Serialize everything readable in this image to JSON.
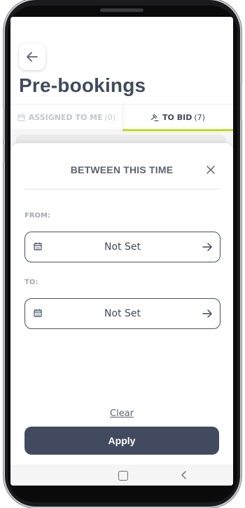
{
  "header": {
    "title": "Pre-bookings"
  },
  "tabs": [
    {
      "label": "ASSIGNED TO ME",
      "count": "(0)",
      "icon": "calendar-icon",
      "active": false
    },
    {
      "label": "TO BID",
      "count": "(7)",
      "icon": "gavel-icon",
      "active": true
    }
  ],
  "sheet": {
    "title": "BETWEEN THIS TIME",
    "from_label": "FROM:",
    "from_value": "Not Set",
    "to_label": "TO:",
    "to_value": "Not Set",
    "clear_label": "Clear",
    "apply_label": "Apply"
  },
  "colors": {
    "primary": "#414a5f",
    "accent": "#c9e51f",
    "muted": "#a6aab3"
  },
  "system_nav": {
    "icons": [
      "home-icon",
      "back-nav-icon"
    ]
  }
}
